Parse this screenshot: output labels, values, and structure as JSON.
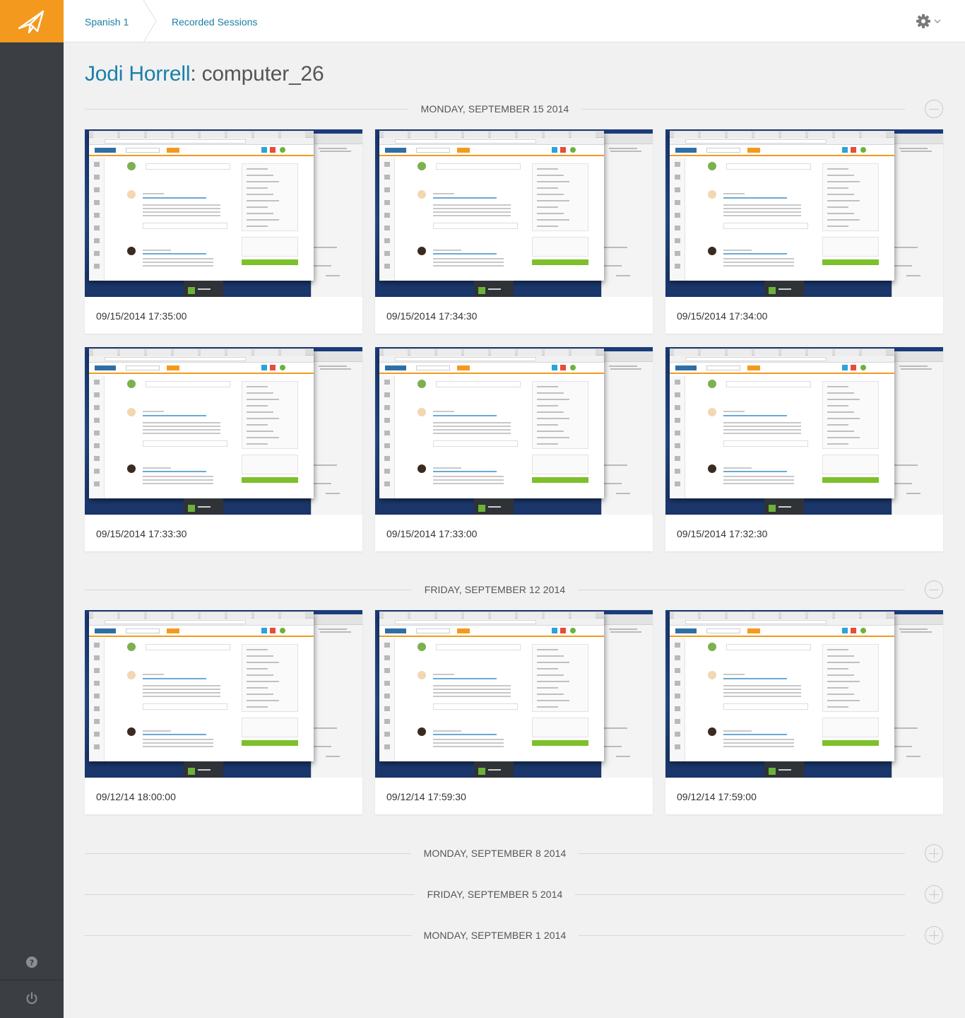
{
  "sidebar": {
    "logo_icon": "paper-plane-icon",
    "help_icon": "help-icon",
    "power_icon": "power-icon"
  },
  "header": {
    "breadcrumb": [
      "Spanish 1",
      "Recorded Sessions"
    ],
    "settings_icon": "gear-icon"
  },
  "title": {
    "user": "Jodi Horrell",
    "separator": ": ",
    "computer": "computer_26"
  },
  "days": [
    {
      "label": "MONDAY, SEPTEMBER 15 2014",
      "expanded": true,
      "sessions": [
        "09/15/2014 17:35:00",
        "09/15/2014 17:34:30",
        "09/15/2014 17:34:00",
        "09/15/2014 17:33:30",
        "09/15/2014 17:33:00",
        "09/15/2014 17:32:30"
      ]
    },
    {
      "label": "FRIDAY, SEPTEMBER 12 2014",
      "expanded": true,
      "sessions": [
        "09/12/14 18:00:00",
        "09/12/14 17:59:30",
        "09/12/14 17:59:00"
      ]
    },
    {
      "label": "MONDAY, SEPTEMBER 8 2014",
      "expanded": false,
      "sessions": []
    },
    {
      "label": "FRIDAY, SEPTEMBER 5 2014",
      "expanded": false,
      "sessions": []
    },
    {
      "label": "MONDAY, SEPTEMBER 1 2014",
      "expanded": false,
      "sessions": []
    }
  ],
  "colors": {
    "accent": "#f39a1e",
    "link": "#1a7fa8",
    "sidebar": "#3b3e42",
    "background": "#f1f1f1"
  }
}
